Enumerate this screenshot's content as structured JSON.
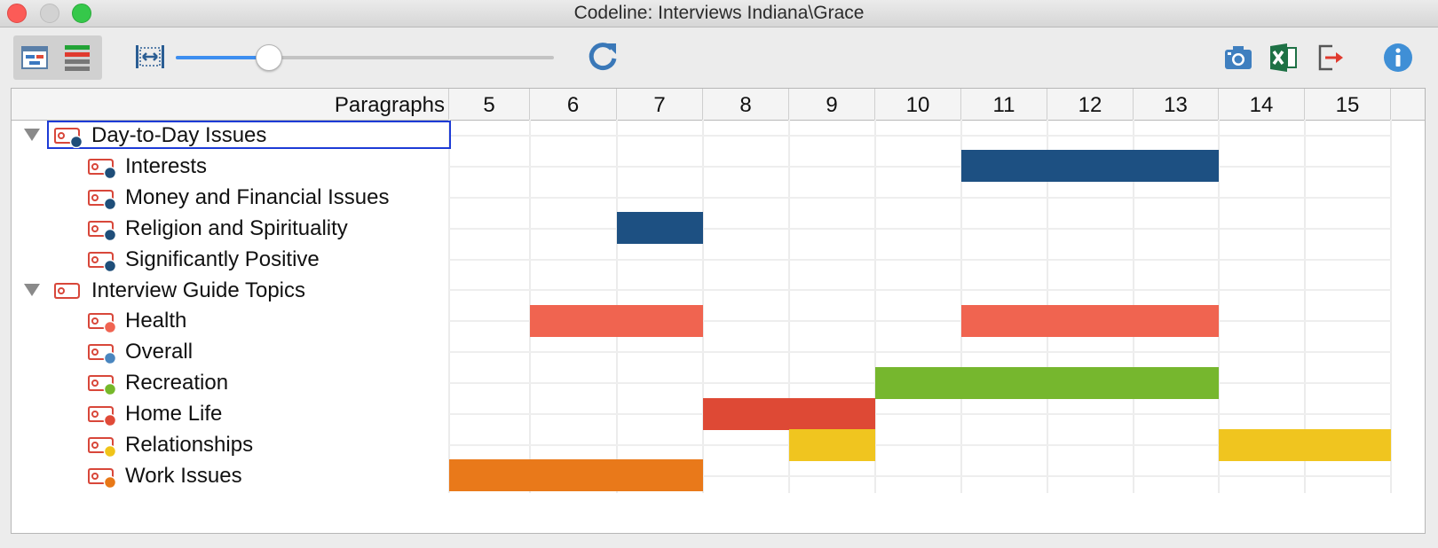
{
  "window": {
    "title": "Codeline: Interviews Indiana\\Grace"
  },
  "toolbar": {
    "view_buttons": [
      "codeline-view",
      "bar-view"
    ],
    "zoom_slider": {
      "value_fraction": 0.26
    },
    "icons": [
      "fit-width-icon",
      "refresh-icon",
      "camera-icon",
      "excel-icon",
      "export-icon",
      "info-icon"
    ]
  },
  "grid": {
    "header_label": "Paragraphs",
    "columns": [
      "5",
      "6",
      "7",
      "8",
      "9",
      "10",
      "11",
      "12",
      "13",
      "14",
      "15"
    ]
  },
  "codes": [
    {
      "label": "Day-to-Day Issues",
      "level": 0,
      "expanded": true,
      "selected": true,
      "dot": "#1f4e79",
      "segments": []
    },
    {
      "label": "Interests",
      "level": 1,
      "dot": "#1f4e79",
      "segments": [
        {
          "from": "11",
          "to": "13",
          "color": "#1d5082"
        }
      ]
    },
    {
      "label": "Money and Financial Issues",
      "level": 1,
      "dot": "#1f4e79",
      "segments": []
    },
    {
      "label": "Religion and Spirituality",
      "level": 1,
      "dot": "#1f4e79",
      "segments": [
        {
          "from": "7",
          "to": "7",
          "color": "#1d5082"
        }
      ]
    },
    {
      "label": "Significantly Positive",
      "level": 1,
      "dot": "#1f4e79",
      "segments": []
    },
    {
      "label": "Interview Guide Topics",
      "level": 0,
      "expanded": true,
      "dot": null,
      "segments": []
    },
    {
      "label": "Health",
      "level": 1,
      "dot": "#f06452",
      "segments": [
        {
          "from": "6",
          "to": "7",
          "color": "#f06450"
        },
        {
          "from": "11",
          "to": "13",
          "color": "#f06450"
        }
      ]
    },
    {
      "label": "Overall",
      "level": 1,
      "dot": "#4a86bf",
      "segments": []
    },
    {
      "label": "Recreation",
      "level": 1,
      "dot": "#76b82a",
      "segments": [
        {
          "from": "10",
          "to": "13",
          "color": "#76b72e"
        }
      ]
    },
    {
      "label": "Home Life",
      "level": 1,
      "dot": "#e04a38",
      "segments": [
        {
          "from": "8",
          "to": "9",
          "color": "#de4935"
        }
      ]
    },
    {
      "label": "Relationships",
      "level": 1,
      "dot": "#f0c419",
      "segments": [
        {
          "from": "9",
          "to": "9",
          "color": "#f0c51f"
        },
        {
          "from": "14",
          "to": "15",
          "color": "#f0c51f"
        }
      ]
    },
    {
      "label": "Work Issues",
      "level": 1,
      "dot": "#e87817",
      "segments": [
        {
          "from": "5",
          "to": "7",
          "color": "#e9791a"
        }
      ]
    }
  ]
}
